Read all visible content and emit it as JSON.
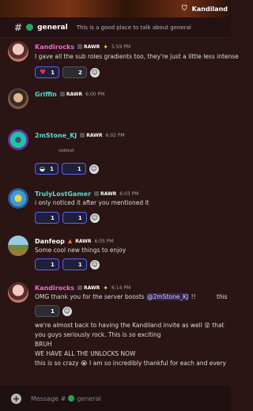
{
  "server": {
    "name": "Kandiland",
    "icon": "server-icon"
  },
  "channel": {
    "name": "general",
    "topic": "This is a good place to talk about general"
  },
  "messages": [
    {
      "author": "Kandirocks",
      "tag": "RAWR",
      "badge": "star-badge",
      "time": "5:59 PM",
      "lines": [
        "I gave all the sub roles gradients too, they're just a little less intense"
      ],
      "reactions": [
        {
          "emoji": "heart-emoji",
          "count": "1"
        },
        {
          "emoji": "",
          "count": "2"
        }
      ]
    },
    {
      "author": "Griffin",
      "tag": "RAWR",
      "time": "6:00 PM"
    },
    {
      "author": "2mStone_KJ",
      "tag": "RAWR",
      "time": "6:02 PM",
      "edited": "(edited)",
      "reactions": [
        {
          "emoji": "custom-emoji",
          "count": "1"
        },
        {
          "emoji": "",
          "count": "1"
        }
      ]
    },
    {
      "author": "TrulyLostGamer",
      "tag": "RAWR",
      "time": "6:03 PM",
      "lines": [
        "i only noticed it after you mentioned it"
      ],
      "reactions": [
        {
          "emoji": "",
          "count": "1"
        },
        {
          "emoji": "",
          "count": "1"
        }
      ]
    },
    {
      "author": "Danfeop",
      "tag": "RAWR",
      "badge": "fire-badge",
      "time": "6:05 PM",
      "lines": [
        "Some cool new things to enjoy"
      ],
      "reactions": [
        {
          "emoji": "",
          "count": "1"
        },
        {
          "emoji": "",
          "count": "1"
        }
      ]
    },
    {
      "author": "Kandirocks",
      "tag": "RAWR",
      "badge": "star-badge",
      "time": "6:14 PM",
      "line1_pre": "OMG thank you for the server boosts",
      "mention": "@2mStone_KJ",
      "line1_post": "!!",
      "line1_tail": "this",
      "reactions": [
        {
          "emoji": "",
          "count": "1"
        }
      ],
      "lines": [
        "we're almost back to having the Kandiland invite as well 😲 that",
        "you guys seriously rock. This is so exciting",
        "BRUH",
        "WE HAVE ALL THE UNLOCKS NOW",
        "this is so crazy 😭 I am so incredibly thankful for each and every"
      ]
    }
  ],
  "composer": {
    "placeholder_prefix": "Message #",
    "channel": "general"
  },
  "colors": {
    "brand_pink": "#ec6bd3",
    "online_green": "#23a55a",
    "reaction_blue": "#5865f2"
  }
}
